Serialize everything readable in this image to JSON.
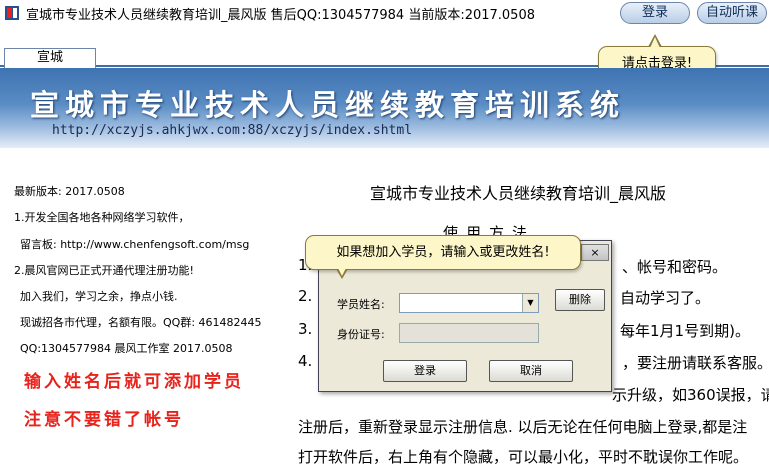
{
  "window": {
    "title": "宣城市专业技术人员继续教育培训_晨风版 售后QQ:1304577984 当前版本:2017.0508",
    "login_button": "登录",
    "autoplay_button": "自动听课"
  },
  "tabs": [
    {
      "label": "宣城"
    }
  ],
  "login_tooltip": "请点击登录!",
  "banner": {
    "title": "宣城市专业技术人员继续教育培训系统",
    "url": "http://xczyjs.ahkjwx.com:88/xczyjs/index.shtml"
  },
  "left_panel": {
    "lines": [
      "最新版本: 2017.0508",
      "1.开发全国各地各种网络学习软件，",
      "留言板: http://www.chenfengsoft.com/msg",
      "2.晨风官网已正式开通代理注册功能!",
      "加入我们，学习之余，挣点小钱.",
      "现诚招各市代理，名额有限。QQ群: 461482445",
      "QQ:1304577984  晨风工作室 2017.0508"
    ],
    "red_notes": [
      "输入姓名后就可添加学员",
      "注意不要错了帐号"
    ]
  },
  "right_panel": {
    "title": "宣城市专业技术人员继续教育培训_晨风版",
    "subtitle": "使用方法",
    "lines": [
      "1.",
      "、帐号和密码。",
      "2.",
      "自动学习了。",
      "3.",
      "每年1月1号到期)。",
      "4.",
      "，要注册请联系客服。",
      "示升级，如360误报，请",
      "注册后，重新登录显示注册信息. 以后无论在任何电脑上登录,都是注",
      "打开软件后，右上角有个隐藏，可以最小化，平时不耽误你工作呢。"
    ]
  },
  "dialog": {
    "hint": "如果想加入学员，请输入或更改姓名!",
    "close_label": "×",
    "name_label": "学员姓名:",
    "name_value": "",
    "id_label": "身份证号:",
    "id_value": "",
    "delete_button": "删除",
    "login_button": "登录",
    "cancel_button": "取消"
  }
}
